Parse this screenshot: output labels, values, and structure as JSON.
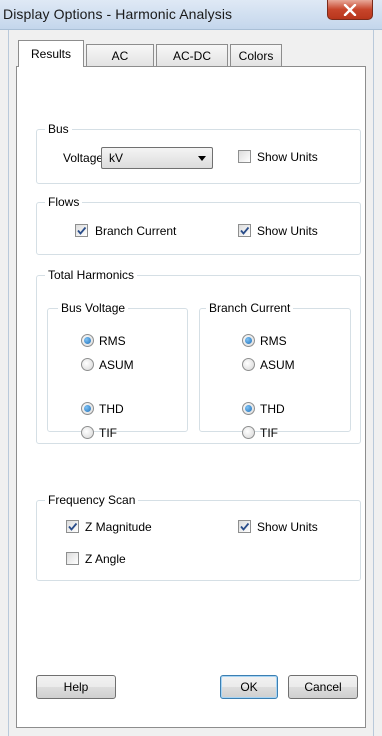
{
  "window": {
    "title": "Display Options - Harmonic Analysis"
  },
  "tabs": [
    {
      "label": "Results",
      "active": true
    },
    {
      "label": "AC",
      "active": false
    },
    {
      "label": "AC-DC",
      "active": false
    },
    {
      "label": "Colors",
      "active": false
    }
  ],
  "bus": {
    "group_label": "Bus",
    "voltage_label": "Voltage",
    "voltage_selected": "kV",
    "show_units_label": "Show Units",
    "show_units_checked": false
  },
  "flows": {
    "group_label": "Flows",
    "branch_current_label": "Branch Current",
    "branch_current_checked": true,
    "show_units_label": "Show Units",
    "show_units_checked": true
  },
  "total_harmonics": {
    "group_label": "Total Harmonics",
    "bus_voltage": {
      "group_label": "Bus Voltage",
      "rms": "RMS",
      "asum": "ASUM",
      "thd": "THD",
      "tif": "TIF",
      "selected_sum": "RMS",
      "selected_index": "THD"
    },
    "branch_current": {
      "group_label": "Branch Current",
      "rms": "RMS",
      "asum": "ASUM",
      "thd": "THD",
      "tif": "TIF",
      "selected_sum": "RMS",
      "selected_index": "THD"
    }
  },
  "frequency_scan": {
    "group_label": "Frequency Scan",
    "z_magnitude_label": "Z Magnitude",
    "z_magnitude_checked": true,
    "show_units_label": "Show Units",
    "show_units_checked": true,
    "z_angle_label": "Z Angle",
    "z_angle_checked": false
  },
  "buttons": {
    "help": "Help",
    "ok": "OK",
    "cancel": "Cancel"
  }
}
